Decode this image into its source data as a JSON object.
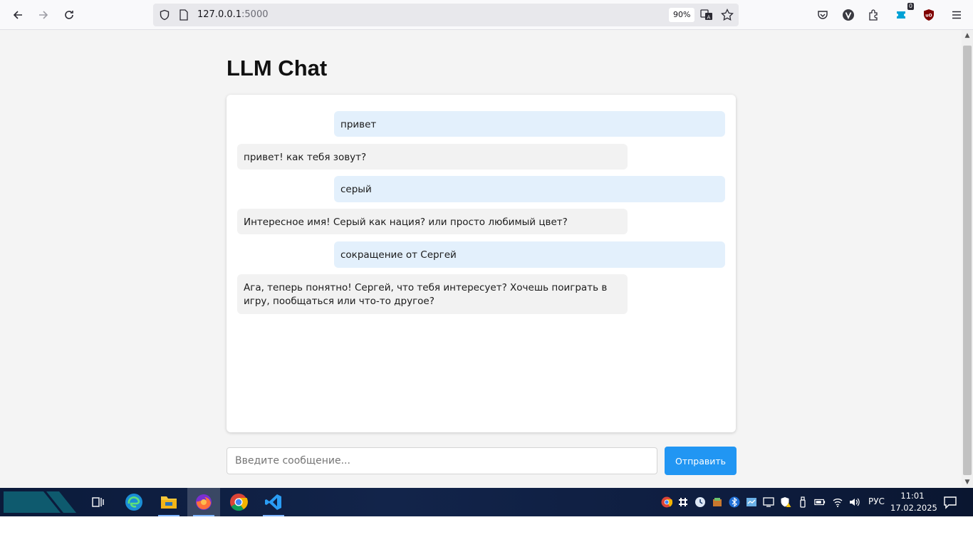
{
  "browser": {
    "url_host": "127.0.0.1",
    "url_port": ":5000",
    "zoom": "90%",
    "extension_badge": "0"
  },
  "page": {
    "title": "LLM Chat",
    "messages": [
      {
        "role": "user",
        "text": "привет"
      },
      {
        "role": "bot",
        "text": "привет! как тебя зовут?"
      },
      {
        "role": "user",
        "text": "серый"
      },
      {
        "role": "bot",
        "text": "Интересное имя! Серый как нация? или просто любимый цвет?"
      },
      {
        "role": "user",
        "text": "сокращение от Сергей"
      },
      {
        "role": "bot",
        "text": "Ага, теперь понятно! Сергей, что тебя интересует? Хочешь поиграть в игру, пообщаться или что-то другое?"
      }
    ],
    "input_placeholder": "Введите сообщение...",
    "send_label": "Отправить"
  },
  "taskbar": {
    "lang": "РУС",
    "time": "11:01",
    "date": "17.02.2025"
  },
  "colors": {
    "user_bubble": "#e3f0fc",
    "bot_bubble": "#f2f2f2",
    "send_button": "#2196f3"
  }
}
